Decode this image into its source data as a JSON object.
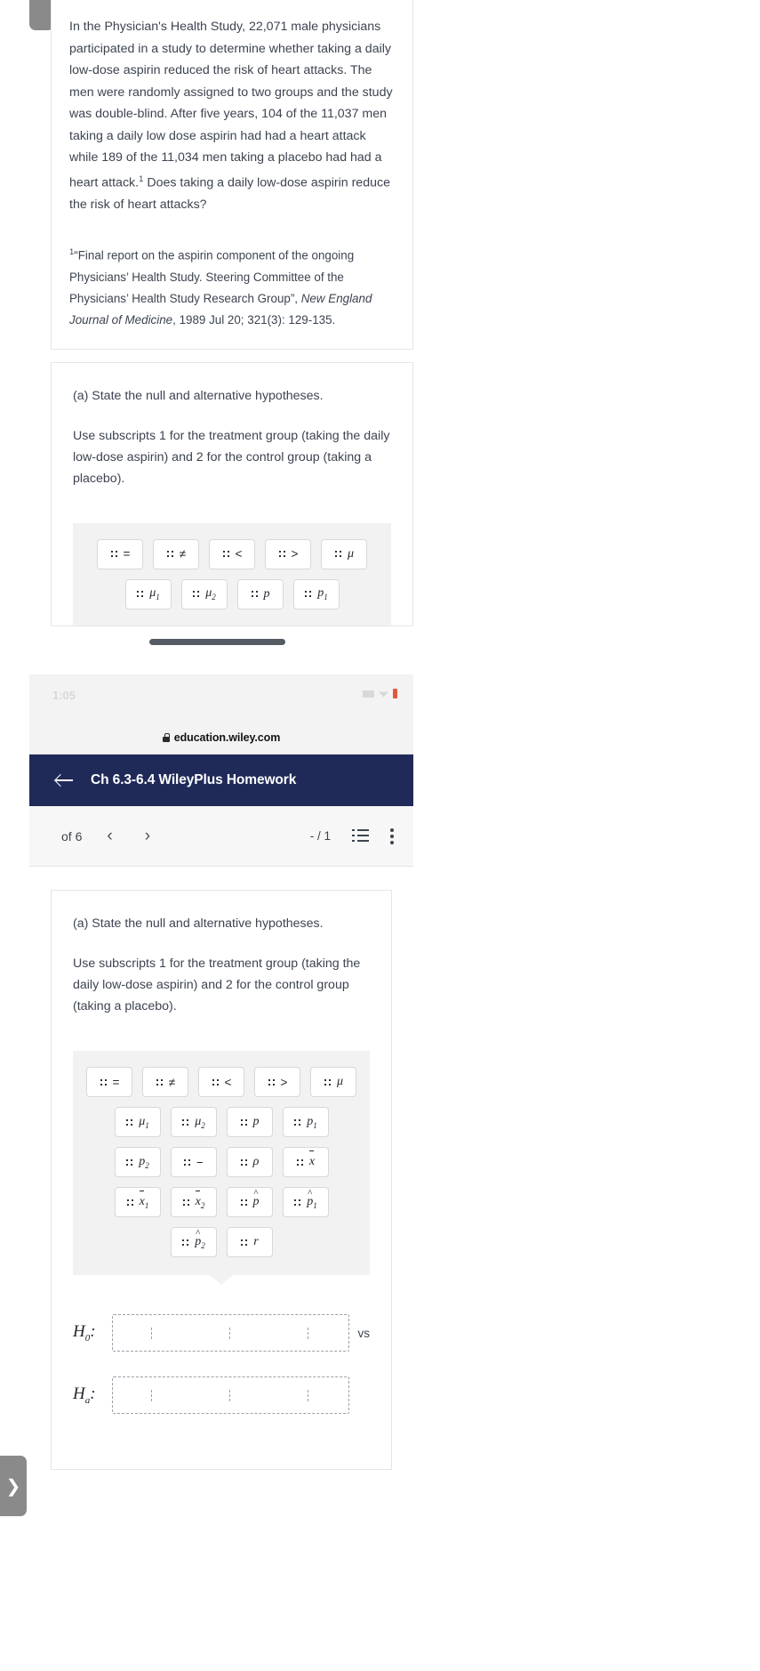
{
  "question": {
    "body": "In the Physician's Health Study, 22,071 male physicians participated in a study to determine whether taking a daily low-dose aspirin reduced the risk of heart attacks. The men were randomly assigned to two groups and the study was double-blind. After five years, 104 of the 11,037 men taking a daily low dose aspirin had had a heart attack while 189 of the 11,034 men taking a placebo had had a heart attack.",
    "footnote_marker": "1",
    "body_tail": " Does taking a daily low-dose aspirin reduce the risk of heart attacks?",
    "citation_marker": "1",
    "citation_part1": "“Final report on the aspirin component of the ongoing Physicians’ Health Study. Steering Committee of the Physicians’ Health Study Research Group”, ",
    "citation_italic": "New England Journal of Medicine",
    "citation_part2": ", 1989 Jul 20; 321(3): 129-135."
  },
  "part_a": {
    "prompt": "(a) State the null and alternative hypotheses.",
    "note": "Use subscripts 1 for the treatment group (taking the daily low-dose aspirin) and 2 for the control group (taking a placebo)."
  },
  "palette": {
    "row1": [
      {
        "name": "equals",
        "label": "=",
        "type": "op"
      },
      {
        "name": "not-equals",
        "label": "≠",
        "type": "op"
      },
      {
        "name": "less-than",
        "label": "<",
        "type": "op"
      },
      {
        "name": "greater-than",
        "label": ">",
        "type": "op"
      },
      {
        "name": "mu",
        "label": "μ",
        "type": "sym"
      }
    ],
    "row2": [
      {
        "name": "mu-1",
        "label": "μ",
        "sub": "1",
        "type": "sym"
      },
      {
        "name": "mu-2",
        "label": "μ",
        "sub": "2",
        "type": "sym"
      },
      {
        "name": "p",
        "label": "p",
        "type": "sym"
      },
      {
        "name": "p-1",
        "label": "p",
        "sub": "1",
        "type": "sym"
      }
    ],
    "row3": [
      {
        "name": "p-2",
        "label": "p",
        "sub": "2",
        "type": "sym"
      },
      {
        "name": "minus",
        "label": "−",
        "type": "op"
      },
      {
        "name": "rho",
        "label": "ρ",
        "type": "sym"
      },
      {
        "name": "x-bar",
        "label": "x",
        "bar": true,
        "type": "sym"
      }
    ],
    "row4": [
      {
        "name": "x-bar-1",
        "label": "x",
        "bar": true,
        "sub": "1",
        "type": "sym"
      },
      {
        "name": "x-bar-2",
        "label": "x",
        "bar": true,
        "sub": "2",
        "type": "sym"
      },
      {
        "name": "p-hat",
        "label": "p",
        "hat": true,
        "type": "sym"
      },
      {
        "name": "p-hat-1",
        "label": "p",
        "hat": true,
        "sub": "1",
        "type": "sym"
      }
    ],
    "row5": [
      {
        "name": "p-hat-2",
        "label": "p",
        "hat": true,
        "sub": "2",
        "type": "sym"
      },
      {
        "name": "r",
        "label": "r",
        "type": "sym"
      }
    ]
  },
  "hypotheses": {
    "null_label": "H",
    "null_sub": "0",
    "null_colon": ":",
    "alt_label": "H",
    "alt_sub": "a",
    "alt_colon": ":",
    "vs": "vs"
  },
  "browser": {
    "status_time": "1:05",
    "url": "education.wiley.com",
    "app_title": "Ch 6.3-6.4 WileyPlus Homework"
  },
  "toolbar": {
    "of_label": "of 6",
    "prev": "‹",
    "next": "›",
    "score": "- / 1",
    "drawer_chevron": "❯"
  }
}
